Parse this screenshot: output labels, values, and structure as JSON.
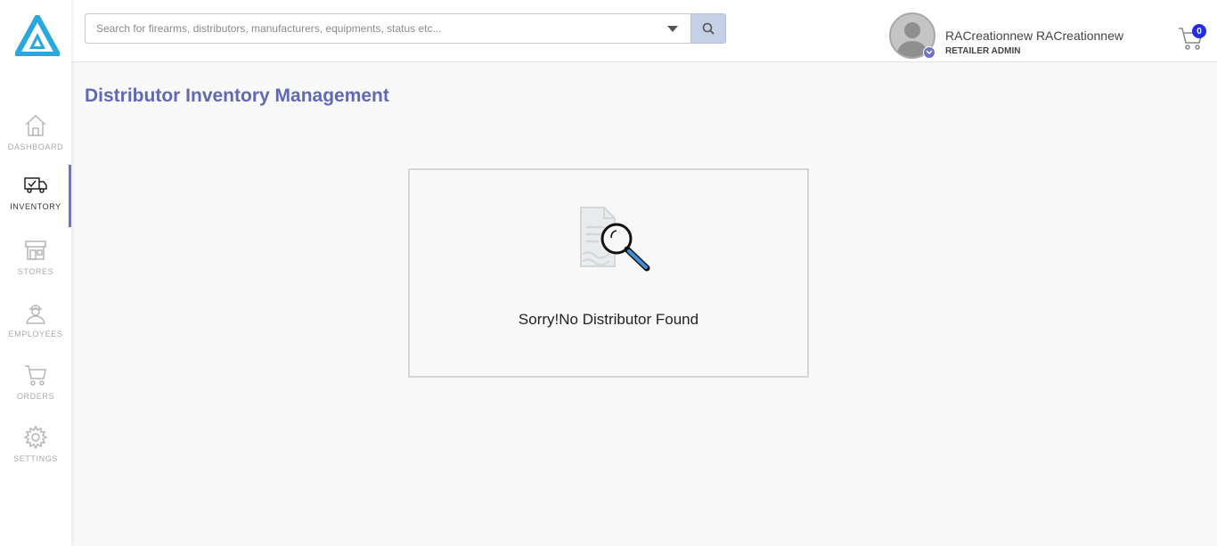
{
  "sidebar": {
    "items": [
      {
        "label": "DASHBOARD",
        "icon": "home-icon"
      },
      {
        "label": "INVENTORY",
        "icon": "delivery-truck-icon"
      },
      {
        "label": "STORES",
        "icon": "store-icon"
      },
      {
        "label": "EMPLOYEES",
        "icon": "employee-icon"
      },
      {
        "label": "ORDERS",
        "icon": "cart-icon"
      },
      {
        "label": "SETTINGS",
        "icon": "gear-icon"
      }
    ],
    "active": "INVENTORY"
  },
  "header": {
    "search_placeholder": "Search for firearms, distributors, manufacturers, equipments, status etc...",
    "user_name": "RACreationnew RACreationnew",
    "user_role": "RETAILER ADMIN",
    "cart_count": "0"
  },
  "main": {
    "page_title": "Distributor Inventory Management",
    "empty_message": "Sorry!No Distributor Found"
  },
  "colors": {
    "accent": "#6f74c4",
    "title": "#6069b5",
    "logo": "#29a8e0",
    "cart_badge": "#1e2ee8"
  }
}
